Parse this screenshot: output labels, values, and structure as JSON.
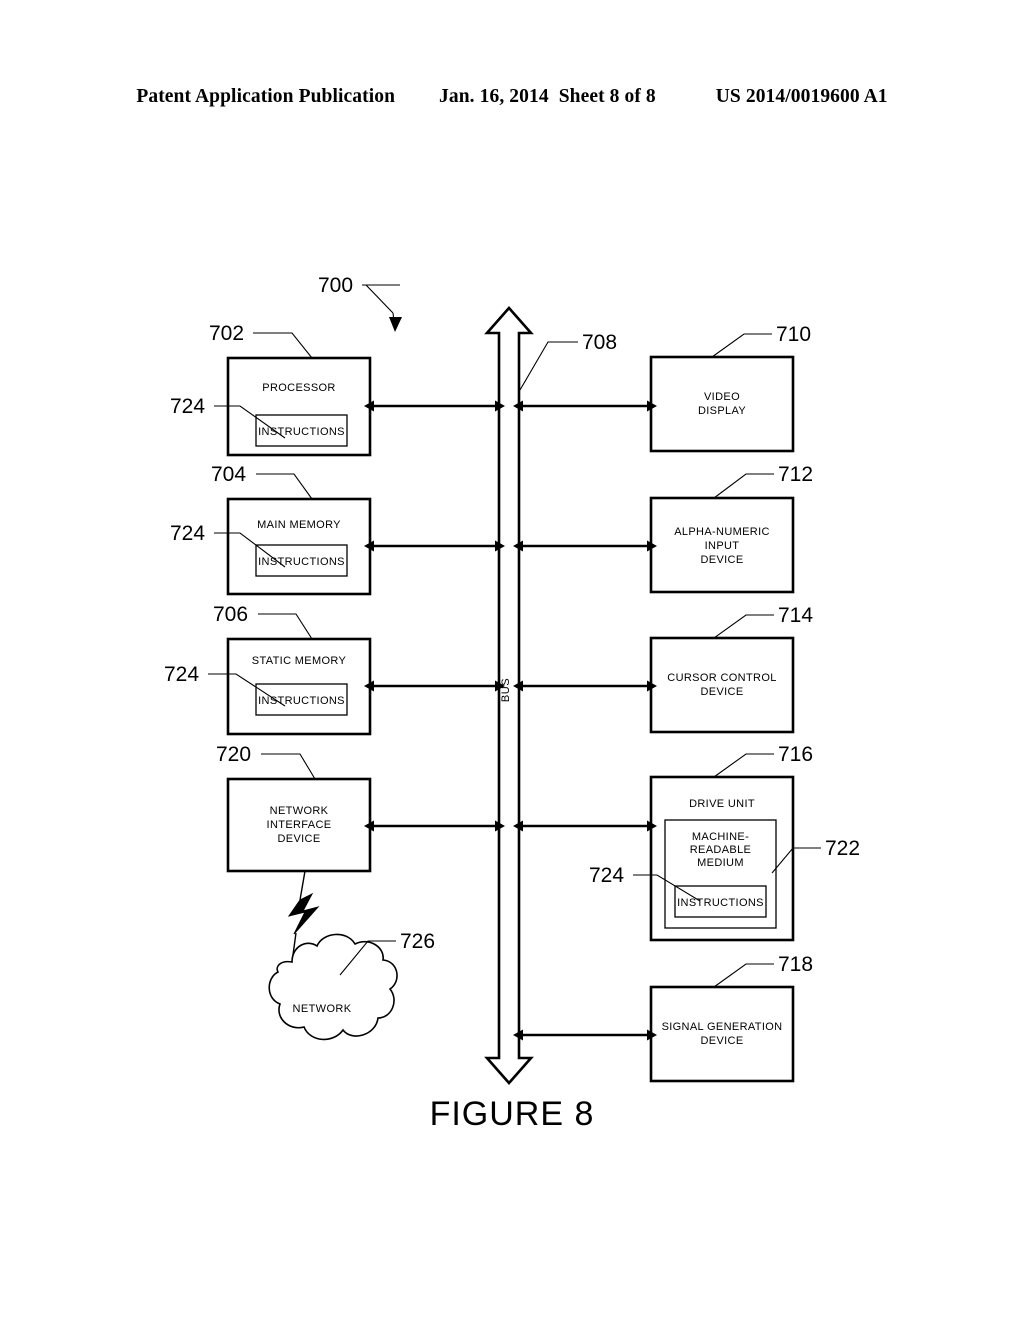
{
  "header": {
    "publication": "Patent Application Publication",
    "date": "Jan. 16, 2014",
    "sheet": "Sheet 8 of 8",
    "patent_number": "US 2014/0019600 A1"
  },
  "figure": {
    "caption": "FIGURE 8",
    "system_ref": "700",
    "bus_label": "BUS",
    "bus_ref": "708"
  },
  "blocks": {
    "processor": {
      "ref": "702",
      "label": "PROCESSOR",
      "inner_label": "INSTRUCTIONS",
      "inner_ref": "724"
    },
    "main_memory": {
      "ref": "704",
      "label": "MAIN MEMORY",
      "inner_label": "INSTRUCTIONS",
      "inner_ref": "724"
    },
    "static_memory": {
      "ref": "706",
      "label": "STATIC MEMORY",
      "inner_label": "INSTRUCTIONS",
      "inner_ref": "724"
    },
    "network_interface": {
      "ref": "720",
      "label_line1": "NETWORK",
      "label_line2": "INTERFACE",
      "label_line3": "DEVICE"
    },
    "video_display": {
      "ref": "710",
      "label_line1": "VIDEO",
      "label_line2": "DISPLAY"
    },
    "alpha_numeric_input": {
      "ref": "712",
      "label_line1": "ALPHA-NUMERIC",
      "label_line2": "INPUT",
      "label_line3": "DEVICE"
    },
    "cursor_control": {
      "ref": "714",
      "label_line1": "CURSOR CONTROL",
      "label_line2": "DEVICE"
    },
    "drive_unit": {
      "ref": "716",
      "label": "DRIVE UNIT",
      "medium_ref": "722",
      "medium_line1": "MACHINE-",
      "medium_line2": "READABLE",
      "medium_line3": "MEDIUM",
      "inner_label": "INSTRUCTIONS",
      "inner_ref": "724"
    },
    "signal_generation": {
      "ref": "718",
      "label_line1": "SIGNAL GENERATION",
      "label_line2": "DEVICE"
    },
    "network_cloud": {
      "ref": "726",
      "label": "NETWORK"
    }
  }
}
